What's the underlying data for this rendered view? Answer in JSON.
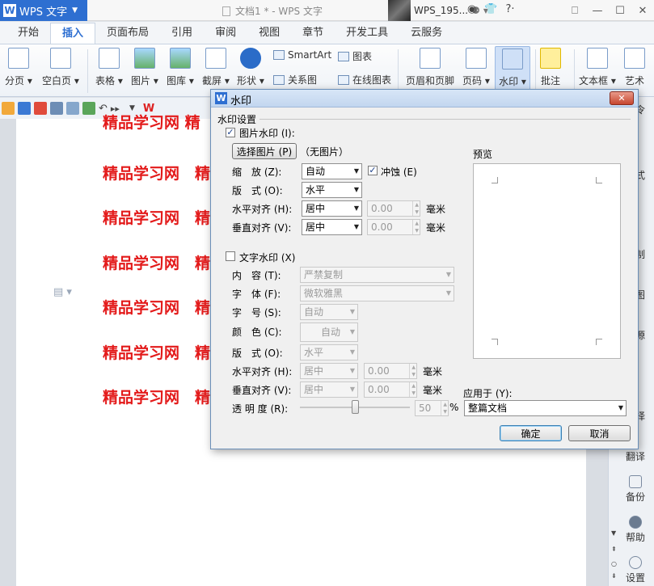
{
  "app": {
    "name": "WPS 文字",
    "logo": "W",
    "document_title": "文档1 * - WPS 文字",
    "user": "WPS_195...",
    "window_controls": [
      "⎕",
      "—",
      "☐",
      "✕"
    ]
  },
  "ribbon": {
    "tabs": [
      "开始",
      "插入",
      "页面布局",
      "引用",
      "审阅",
      "视图",
      "章节",
      "开发工具",
      "云服务"
    ],
    "active_tab": "插入",
    "buttons": {
      "page_break": "分页",
      "blank_page": "空白页",
      "table": "表格",
      "picture": "图片",
      "gallery": "图库",
      "screenshot": "截屏",
      "shape": "形状",
      "smartart": "SmartArt",
      "chart": "图表",
      "relation": "关系图",
      "online_chart": "在线图表",
      "header_footer": "页眉和页脚",
      "page_number": "页码",
      "watermark": "水印",
      "comment": "批注",
      "textbox": "文本框",
      "art": "艺术"
    }
  },
  "document": {
    "line_text": "精品学习网",
    "partial_char": "精",
    "partial_top": "精品学习网  精"
  },
  "sidebar": {
    "partial_top": "令",
    "partial_labels": [
      "式",
      "制",
      "图",
      "源",
      "择"
    ],
    "items": [
      {
        "icon": "translate-icon",
        "label": "翻译"
      },
      {
        "icon": "backup-icon",
        "label": "备份"
      },
      {
        "icon": "help-icon",
        "label": "帮助"
      },
      {
        "icon": "gear-icon",
        "label": "设置"
      }
    ]
  },
  "dialog": {
    "title": "水印",
    "group_title": "水印设置",
    "picture_watermark": {
      "checkbox_label": "图片水印 (I):",
      "checked": true,
      "select_button": "选择图片 (P)",
      "no_picture": "（无图片）",
      "scale_label": "缩　放 (Z):",
      "scale_value": "自动",
      "washout_label": "冲蚀 (E)",
      "washout_checked": true,
      "layout_label": "版　式 (O):",
      "layout_value": "水平",
      "h_align_label": "水平对齐 (H):",
      "h_align_value": "居中",
      "h_offset": "0.00",
      "v_align_label": "垂直对齐 (V):",
      "v_align_value": "居中",
      "v_offset": "0.00",
      "unit": "毫米"
    },
    "text_watermark": {
      "checkbox_label": "文字水印 (X)",
      "checked": false,
      "content_label": "内　容 (T):",
      "content_value": "严禁复制",
      "font_label": "字　体 (F):",
      "font_value": "微软雅黑",
      "size_label": "字　号 (S):",
      "size_value": "自动",
      "color_label": "颜　色 (C):",
      "color_value": "自动",
      "layout_label": "版　式 (O):",
      "layout_value": "水平",
      "h_align_label": "水平对齐 (H):",
      "h_align_value": "居中",
      "h_offset": "0.00",
      "v_align_label": "垂直对齐 (V):",
      "v_align_value": "居中",
      "v_offset": "0.00",
      "unit": "毫米",
      "transparency_label": "透 明 度 (R):",
      "transparency_value": "50",
      "percent": "%"
    },
    "preview_label": "预览",
    "apply_to_label": "应用于 (Y):",
    "apply_to_value": "整篇文档",
    "ok_button": "确定",
    "cancel_button": "取消"
  },
  "colors": {
    "accent": "#2e6fd1",
    "watermark_text": "#e31a1a",
    "dialog_bg": "#f0f0f0"
  }
}
